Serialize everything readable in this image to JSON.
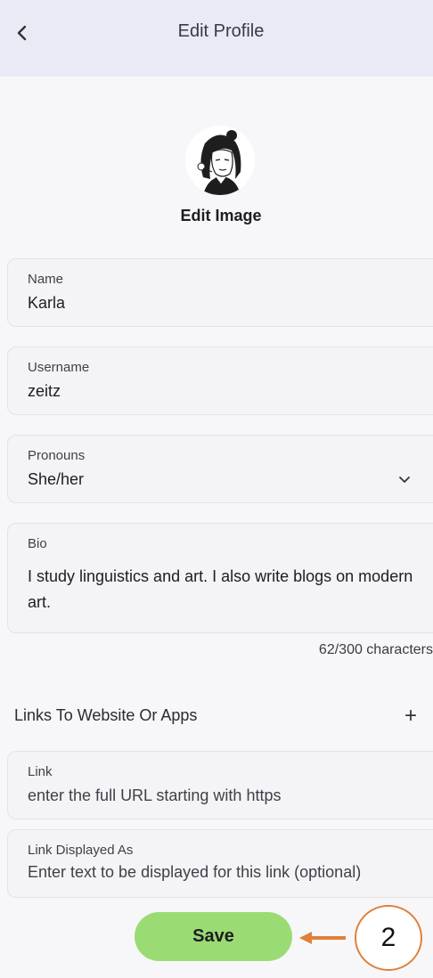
{
  "header": {
    "title": "Edit Profile",
    "back_icon": "chevron-left-icon"
  },
  "profile": {
    "edit_image_label": "Edit Image",
    "avatar_icon": "avatar-illustration"
  },
  "form": {
    "name": {
      "label": "Name",
      "value": "Karla"
    },
    "username": {
      "label": "Username",
      "value": "zeitz"
    },
    "pronouns": {
      "label": "Pronouns",
      "value": "She/her",
      "icon": "chevron-down-icon"
    },
    "bio": {
      "label": "Bio",
      "value": "I study linguistics and art. I also write blogs on modern art.",
      "counter": "62/300 characters"
    }
  },
  "links": {
    "section_title": "Links To Website Or Apps",
    "add_icon": "plus-icon",
    "add_glyph": "+",
    "link": {
      "label": "Link",
      "placeholder": "enter the full URL starting with https"
    },
    "display": {
      "label": "Link Displayed As",
      "placeholder": "Enter text to be displayed for this link (optional)"
    }
  },
  "actions": {
    "save_label": "Save"
  },
  "annotation": {
    "step_number": "2",
    "color": "#e0803a"
  },
  "colors": {
    "header_bg": "#e9eaf6",
    "save_button": "#9bdb74",
    "page_bg": "#f7f7fa"
  }
}
